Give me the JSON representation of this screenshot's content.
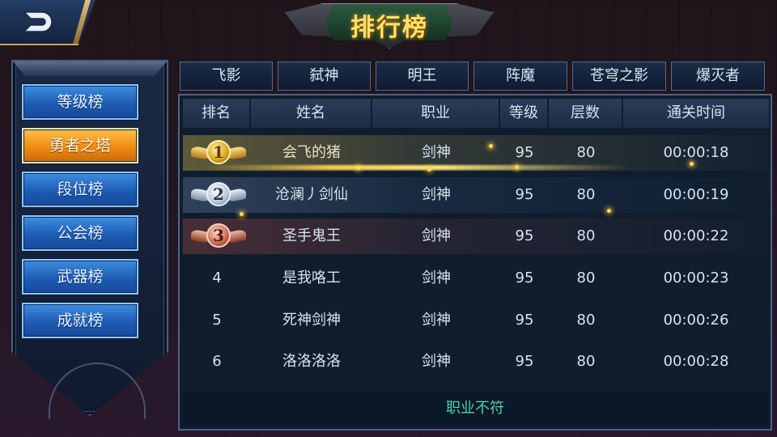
{
  "title": "排行榜",
  "sidebar": {
    "items": [
      {
        "label": "等级榜"
      },
      {
        "label": "勇者之塔",
        "active": true
      },
      {
        "label": "段位榜"
      },
      {
        "label": "公会榜"
      },
      {
        "label": "武器榜"
      },
      {
        "label": "成就榜"
      }
    ]
  },
  "tabs": [
    "飞影",
    "弑神",
    "明王",
    "阵魔",
    "苍穹之影",
    "爆灭者"
  ],
  "table": {
    "headers": [
      "排名",
      "姓名",
      "职业",
      "等级",
      "层数",
      "通关时间"
    ],
    "rows": [
      {
        "rank": "1",
        "name": "会飞的猪",
        "class": "剑神",
        "level": "95",
        "floor": "80",
        "time": "00:00:18"
      },
      {
        "rank": "2",
        "name": "沧澜丿剑仙",
        "class": "剑神",
        "level": "95",
        "floor": "80",
        "time": "00:00:19"
      },
      {
        "rank": "3",
        "name": "圣手鬼王",
        "class": "剑神",
        "level": "95",
        "floor": "80",
        "time": "00:00:22"
      },
      {
        "rank": "4",
        "name": "是我咯工",
        "class": "剑神",
        "level": "95",
        "floor": "80",
        "time": "00:00:23"
      },
      {
        "rank": "5",
        "name": "死神剑神",
        "class": "剑神",
        "level": "95",
        "floor": "80",
        "time": "00:00:26"
      },
      {
        "rank": "6",
        "name": "洛洛洛洛",
        "class": "剑神",
        "level": "95",
        "floor": "80",
        "time": "00:00:28"
      }
    ]
  },
  "footer": {
    "status": "职业不符"
  },
  "colors": {
    "gold": "#ffc14a",
    "accent_blue": "#2f7ad6",
    "status_green": "#4fd2a8"
  },
  "icons": {
    "back": "back-arrow-icon",
    "medal_1": "gold-medal-icon",
    "medal_2": "silver-medal-icon",
    "medal_3": "bronze-medal-icon"
  }
}
